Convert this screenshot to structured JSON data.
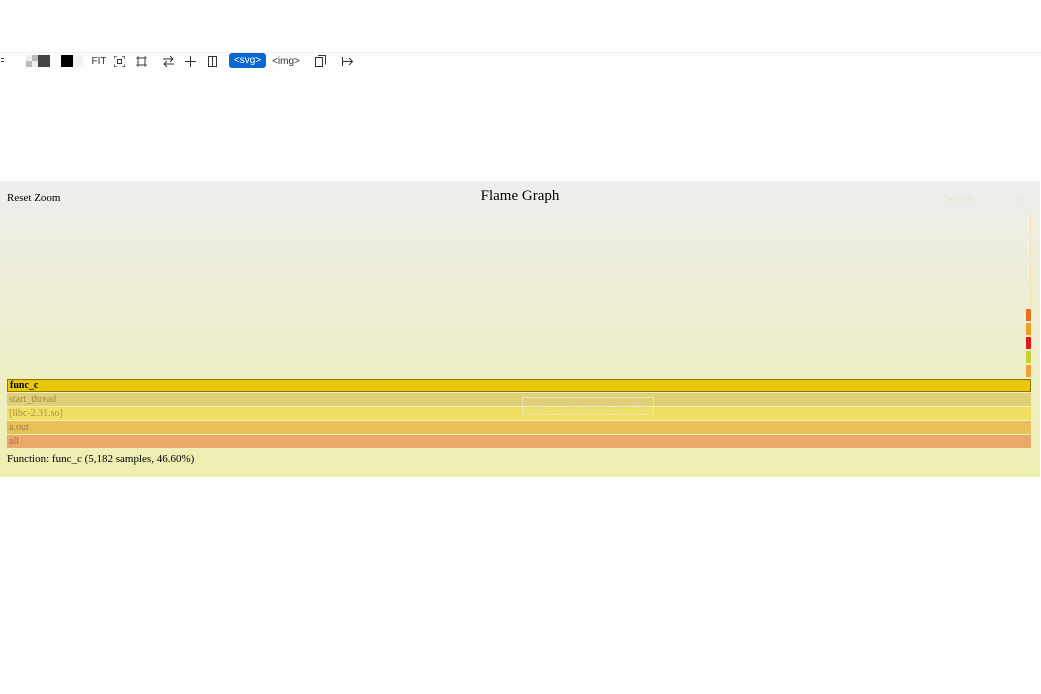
{
  "toolbar": {
    "fit_label": "FIT",
    "svg_label": "<svg>",
    "img_label": "<img>",
    "icons": [
      "menu-icon",
      "checker-light-icon",
      "checker-dark-icon",
      "black-swatch-icon",
      "fit-icon",
      "zoom-to-content-icon",
      "actual-size-icon",
      "swap-icon",
      "crosshair-icon",
      "panel-icon",
      "copy-icon",
      "arrow-right-icon"
    ]
  },
  "flame": {
    "reset_zoom": "Reset Zoom",
    "title": "Flame Graph",
    "search": "Search",
    "ic": "ic",
    "frames": [
      {
        "label": "func_c"
      },
      {
        "label": "start_thread"
      },
      {
        "label": "[libc-2.31.so]"
      },
      {
        "label": "a.out"
      },
      {
        "label": "all"
      }
    ],
    "ghost_tooltip": "func_c (5,182 samples, 46.60%)",
    "details": "Function: func_c (5,182 samples, 46.60%)",
    "colors": {
      "func_c": "#e8c70c",
      "start_thread": "#dfcf76",
      "libc": "#f1de64",
      "a_out": "#e7c157",
      "all": "#eaa96a",
      "accent": "#0a66d0"
    }
  }
}
